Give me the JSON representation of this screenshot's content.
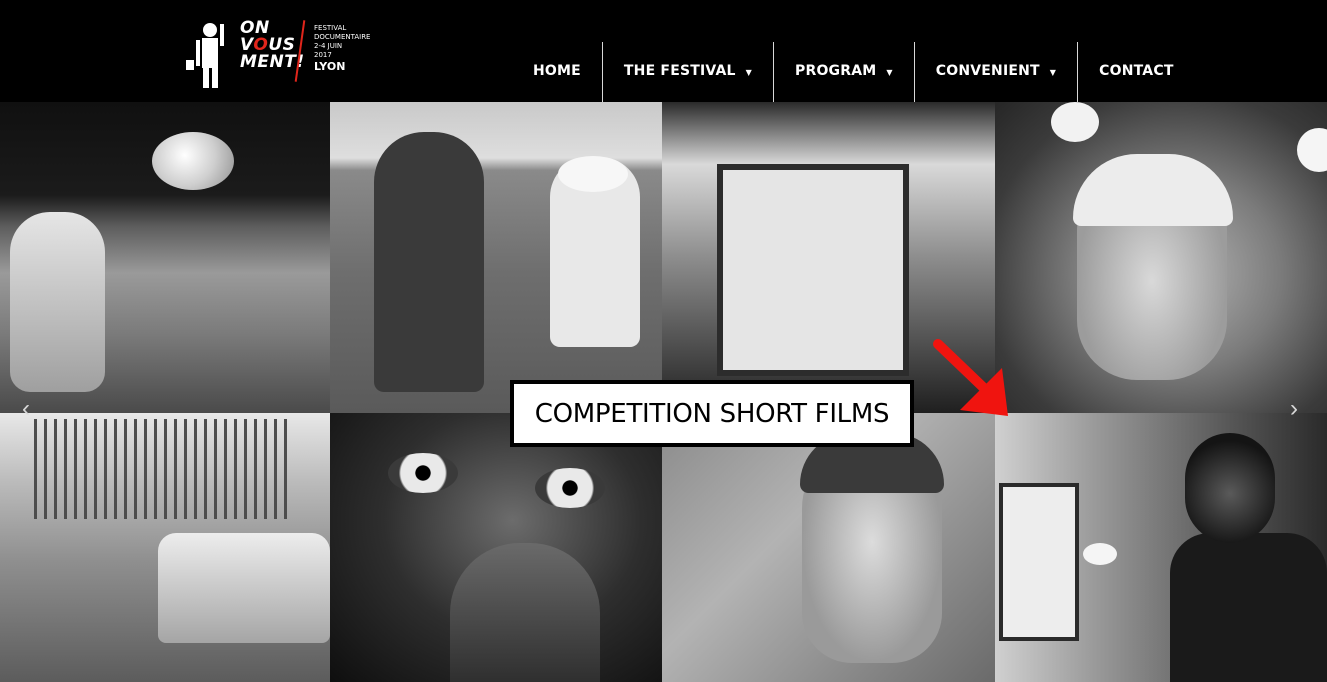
{
  "site": {
    "logo": {
      "line1": "ON",
      "line2_a": "V",
      "line2_o": "O",
      "line2_b": "US",
      "line3": "MENT!",
      "side_line1": "FESTIVAL",
      "side_line2": "DOCUMENTAIRE",
      "side_line3": "2-4 JUIN",
      "side_line4": "2017",
      "side_city": "LYON"
    }
  },
  "nav": {
    "items": [
      {
        "label": "HOME",
        "has_dropdown": false
      },
      {
        "label": "THE FESTIVAL",
        "has_dropdown": true
      },
      {
        "label": "PROGRAM",
        "has_dropdown": true
      },
      {
        "label": "CONVENIENT",
        "has_dropdown": true
      },
      {
        "label": "CONTACT",
        "has_dropdown": false
      }
    ],
    "caret": "▼"
  },
  "gallery": {
    "banner": "COMPETITION SHORT FILMS",
    "arrow_prev": "‹",
    "arrow_next": "›",
    "annotation_color": "#f0140f"
  }
}
